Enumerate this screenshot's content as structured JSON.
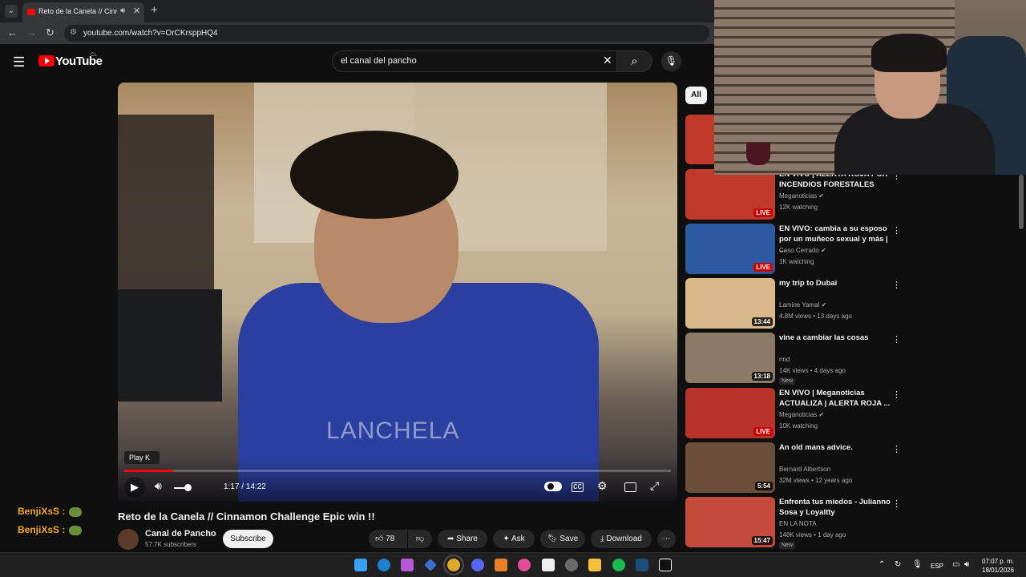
{
  "browser": {
    "tab_title": "Reto de la Canela // Cinnam",
    "url": "youtube.com/watch?v=OrCKrsppHQ4"
  },
  "youtube": {
    "logo": "YouTube",
    "country": "CL",
    "search_value": "el canal del pancho"
  },
  "player": {
    "tooltip_label": "Play",
    "tooltip_key": "K",
    "time": "1:17 / 14:22",
    "progress": 0.09,
    "volume": 0.6,
    "shirt_text": "LANCHELA"
  },
  "video": {
    "title": "Reto de la Canela // Cinnamon Challenge Epic win !!",
    "channel": "Canal de Pancho",
    "subscribers": "57.7K subscribers",
    "subscribe_label": "Subscribe",
    "likes": "78",
    "share_label": "Share",
    "ask_label": "Ask",
    "save_label": "Save",
    "download_label": "Download"
  },
  "chat": [
    {
      "user": "BenjiXsS :"
    },
    {
      "user": "BenjiXsS :"
    }
  ],
  "sidebar": {
    "chip_all": "All",
    "items": [
      {
        "title": "EN VIVO | ALERTA ROJA POR INCENDIOS FORESTALES",
        "channel": "Meganoticias",
        "verified": true,
        "meta": "12K watching",
        "badge": "LIVE",
        "color": "#c0392b"
      },
      {
        "title": "EN VIVO: cambia a su esposo por un muñeco sexual y más | ...",
        "channel": "Caso Cerrado",
        "verified": true,
        "meta": "1K watching",
        "badge": "LIVE",
        "color": "#2c5aa0"
      },
      {
        "title": "my trip to Dubai",
        "channel": "Lamine Yamal",
        "verified": true,
        "meta": "4.8M views • 13 days ago",
        "badge": "13:44",
        "color": "#d9b98a"
      },
      {
        "title": "vine a cambiar las cosas",
        "channel": "nnd",
        "verified": false,
        "meta": "14K views • 4 days ago",
        "badge": "13:18",
        "new": "New",
        "color": "#8a7a66"
      },
      {
        "title": "EN VIVO | Meganoticias ACTUALIZA | ALERTA ROJA ...",
        "channel": "Meganoticias",
        "verified": true,
        "meta": "10K watching",
        "badge": "LIVE",
        "color": "#b8342a"
      },
      {
        "title": "An old mans advice.",
        "channel": "Bernard Albertson",
        "verified": false,
        "meta": "32M views • 12 years ago",
        "badge": "5:54",
        "color": "#6b4f3a"
      },
      {
        "title": "Enfrenta tus miedos - Julianno Sosa y Loyaltty",
        "channel": "EN LA NOTA",
        "verified": false,
        "meta": "148K views • 1 day ago",
        "badge": "15:47",
        "new": "New",
        "color": "#c44a3a"
      }
    ]
  },
  "taskbar": {
    "language": "ESP",
    "time": "07:07 p. m.",
    "date": "18/01/2026"
  }
}
